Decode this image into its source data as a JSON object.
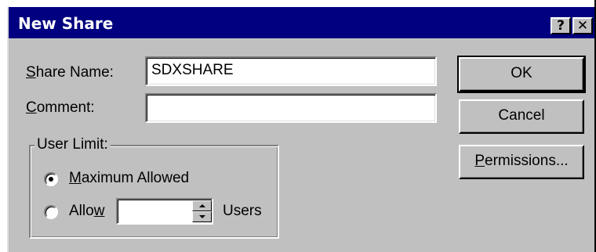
{
  "dialog": {
    "title": "New Share",
    "help_button": "?",
    "close_button": "✕"
  },
  "fields": {
    "share_name": {
      "label_mnemonic": "S",
      "label_rest": "hare Name:",
      "value": "SDXSHARE"
    },
    "comment": {
      "label_mnemonic": "C",
      "label_rest": "omment:",
      "value": ""
    }
  },
  "user_limit": {
    "legend": "User Limit:",
    "maximum": {
      "label_mnemonic": "M",
      "label_rest": "aximum Allowed",
      "selected": true
    },
    "allow": {
      "label_pre": "Allo",
      "label_mnemonic": "w",
      "value": "",
      "suffix": "Users",
      "selected": false
    }
  },
  "buttons": {
    "ok": "OK",
    "cancel": "Cancel",
    "permissions_mnemonic": "P",
    "permissions_rest": "ermissions..."
  },
  "colors": {
    "titlebar": "#000080",
    "face": "#c0c0c0"
  }
}
